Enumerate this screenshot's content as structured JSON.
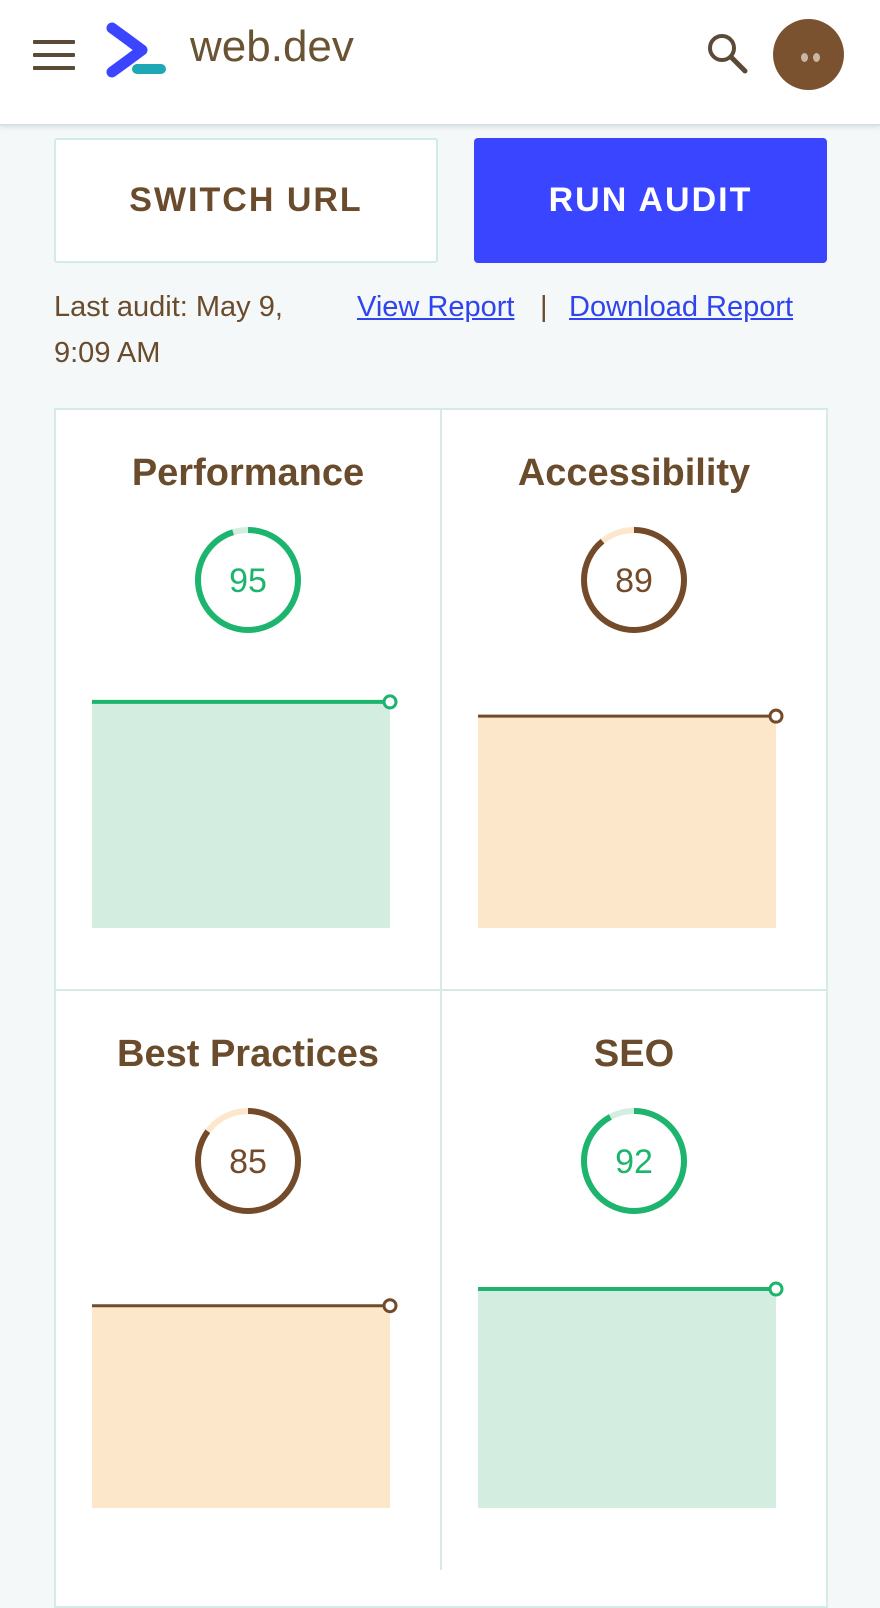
{
  "header": {
    "logo_text": "web.dev",
    "menu_icon": "hamburger-menu-icon",
    "logo_icon": "web-dev-chevron-logo-icon",
    "search_icon": "search-icon",
    "avatar_icon": "user-avatar-icon"
  },
  "actions": {
    "switch_url_label": "SWITCH URL",
    "run_audit_label": "RUN AUDIT"
  },
  "audit": {
    "last_audit_text": "Last audit: May 9, 9:09 AM",
    "view_report_label": "View Report",
    "separator": "|",
    "download_report_label": "Download Report"
  },
  "colors": {
    "good": "#1db56e",
    "good_fill": "#d3ede0",
    "average": "#744b2a",
    "average_fill": "#fde7cb",
    "average_track": "#fde7cb",
    "accent_button": "#3a45ff"
  },
  "cards": [
    {
      "title": "Performance",
      "score": 95,
      "status": "good"
    },
    {
      "title": "Accessibility",
      "score": 89,
      "status": "average"
    },
    {
      "title": "Best Practices",
      "score": 85,
      "status": "average"
    },
    {
      "title": "SEO",
      "score": 92,
      "status": "good"
    }
  ],
  "chart_data": [
    {
      "type": "area",
      "title": "Performance",
      "values": [
        95
      ],
      "ylim": [
        0,
        100
      ]
    },
    {
      "type": "area",
      "title": "Accessibility",
      "values": [
        89
      ],
      "ylim": [
        0,
        100
      ]
    },
    {
      "type": "area",
      "title": "Best Practices",
      "values": [
        85
      ],
      "ylim": [
        0,
        100
      ]
    },
    {
      "type": "area",
      "title": "SEO",
      "values": [
        92
      ],
      "ylim": [
        0,
        100
      ]
    }
  ]
}
